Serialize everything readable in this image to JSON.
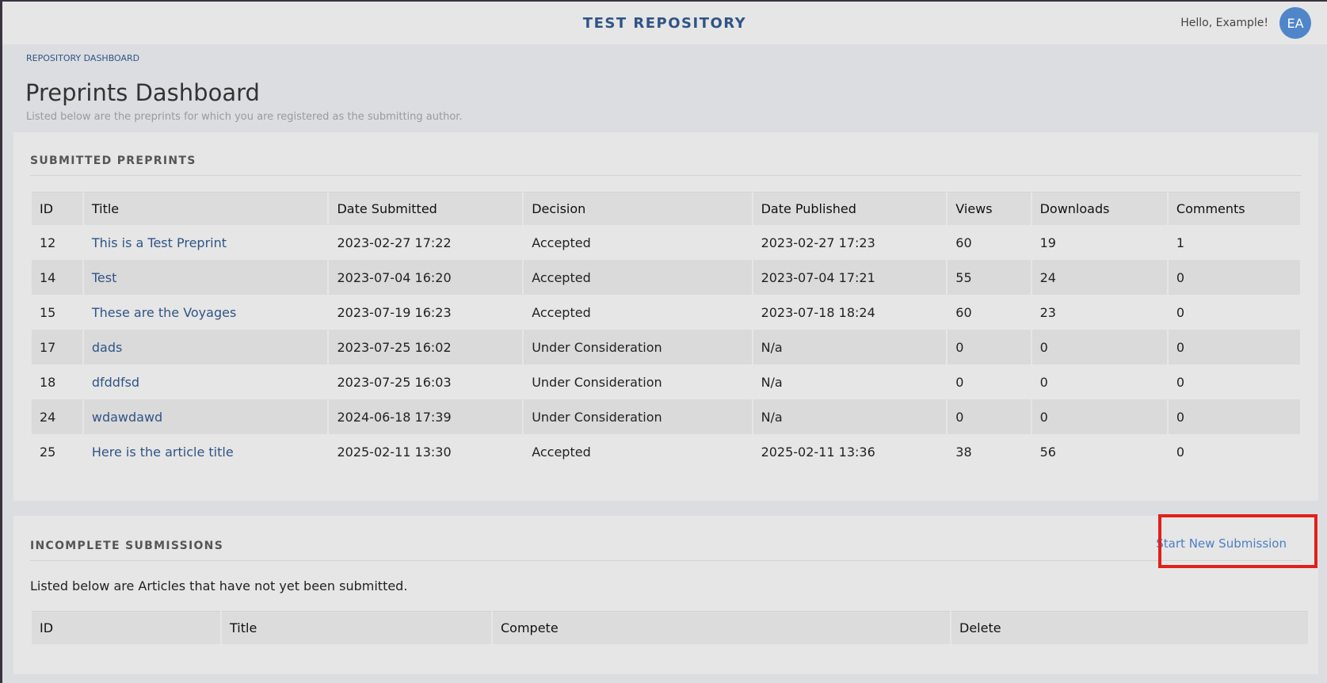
{
  "header": {
    "site_title": "TEST REPOSITORY",
    "greeting": "Hello, Example!",
    "avatar_initials": "EA"
  },
  "breadcrumb": "REPOSITORY DASHBOARD",
  "page": {
    "title": "Preprints Dashboard",
    "subtitle": "Listed below are the preprints for which you are registered as the submitting author."
  },
  "submitted": {
    "heading": "SUBMITTED PREPRINTS",
    "columns": [
      "ID",
      "Title",
      "Date Submitted",
      "Decision",
      "Date Published",
      "Views",
      "Downloads",
      "Comments"
    ],
    "rows": [
      {
        "id": "12",
        "title": "This is a Test Preprint",
        "date_submitted": "2023-02-27 17:22",
        "decision": "Accepted",
        "date_published": "2023-02-27 17:23",
        "views": "60",
        "downloads": "19",
        "comments": "1"
      },
      {
        "id": "14",
        "title": "Test",
        "date_submitted": "2023-07-04 16:20",
        "decision": "Accepted",
        "date_published": "2023-07-04 17:21",
        "views": "55",
        "downloads": "24",
        "comments": "0"
      },
      {
        "id": "15",
        "title": "These are the Voyages",
        "date_submitted": "2023-07-19 16:23",
        "decision": "Accepted",
        "date_published": "2023-07-18 18:24",
        "views": "60",
        "downloads": "23",
        "comments": "0"
      },
      {
        "id": "17",
        "title": "dads",
        "date_submitted": "2023-07-25 16:02",
        "decision": "Under Consideration",
        "date_published": "N/a",
        "views": "0",
        "downloads": "0",
        "comments": "0"
      },
      {
        "id": "18",
        "title": "dfddfsd",
        "date_submitted": "2023-07-25 16:03",
        "decision": "Under Consideration",
        "date_published": "N/a",
        "views": "0",
        "downloads": "0",
        "comments": "0"
      },
      {
        "id": "24",
        "title": "wdawdawd",
        "date_submitted": "2024-06-18 17:39",
        "decision": "Under Consideration",
        "date_published": "N/a",
        "views": "0",
        "downloads": "0",
        "comments": "0"
      },
      {
        "id": "25",
        "title": "Here is the article title",
        "date_submitted": "2025-02-11 13:30",
        "decision": "Accepted",
        "date_published": "2025-02-11 13:36",
        "views": "38",
        "downloads": "56",
        "comments": "0"
      }
    ]
  },
  "incomplete": {
    "heading": "INCOMPLETE SUBMISSIONS",
    "new_submission_label": "Start New Submission",
    "info": "Listed below are Articles that have not yet been submitted.",
    "columns": [
      "ID",
      "Title",
      "Compete",
      "Delete"
    ]
  },
  "colors": {
    "brand_blue": "#2f5486",
    "link_blue": "#4a7fc1",
    "avatar_bg": "#4f86c9",
    "highlight_red": "#e0201a"
  }
}
